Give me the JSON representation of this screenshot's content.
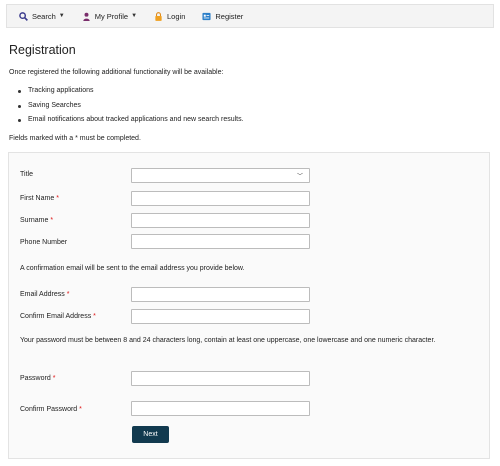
{
  "nav": {
    "search_label": "Search",
    "profile_label": "My Profile",
    "login_label": "Login",
    "register_label": "Register",
    "icons": [
      "search-icon",
      "user-icon",
      "lock-icon",
      "register-icon"
    ]
  },
  "page": {
    "title": "Registration",
    "intro": "Once registered the following additional functionality will be available:",
    "features": [
      "Tracking applications",
      "Saving Searches",
      "Email notifications about tracked applications and new search results."
    ],
    "required_note": "Fields marked with a * must be completed."
  },
  "form": {
    "title_label": "Title",
    "title_value": "",
    "first_name_label": "First Name",
    "surname_label": "Surname",
    "phone_label": "Phone Number",
    "email_info": "A confirmation email will be sent to the email address you provide below.",
    "email_label": "Email Address",
    "confirm_email_label": "Confirm Email Address",
    "password_info": "Your password must be between 8 and 24 characters long, contain at least one uppercase, one lowercase and one numeric character.",
    "password_label": "Password",
    "confirm_password_label": "Confirm Password",
    "required_mark": "*",
    "next_label": "Next"
  },
  "colors": {
    "accent": "#123a4f",
    "required": "#dd1111",
    "navbar_bg": "#f4f4f4",
    "form_bg": "#fafafa"
  }
}
